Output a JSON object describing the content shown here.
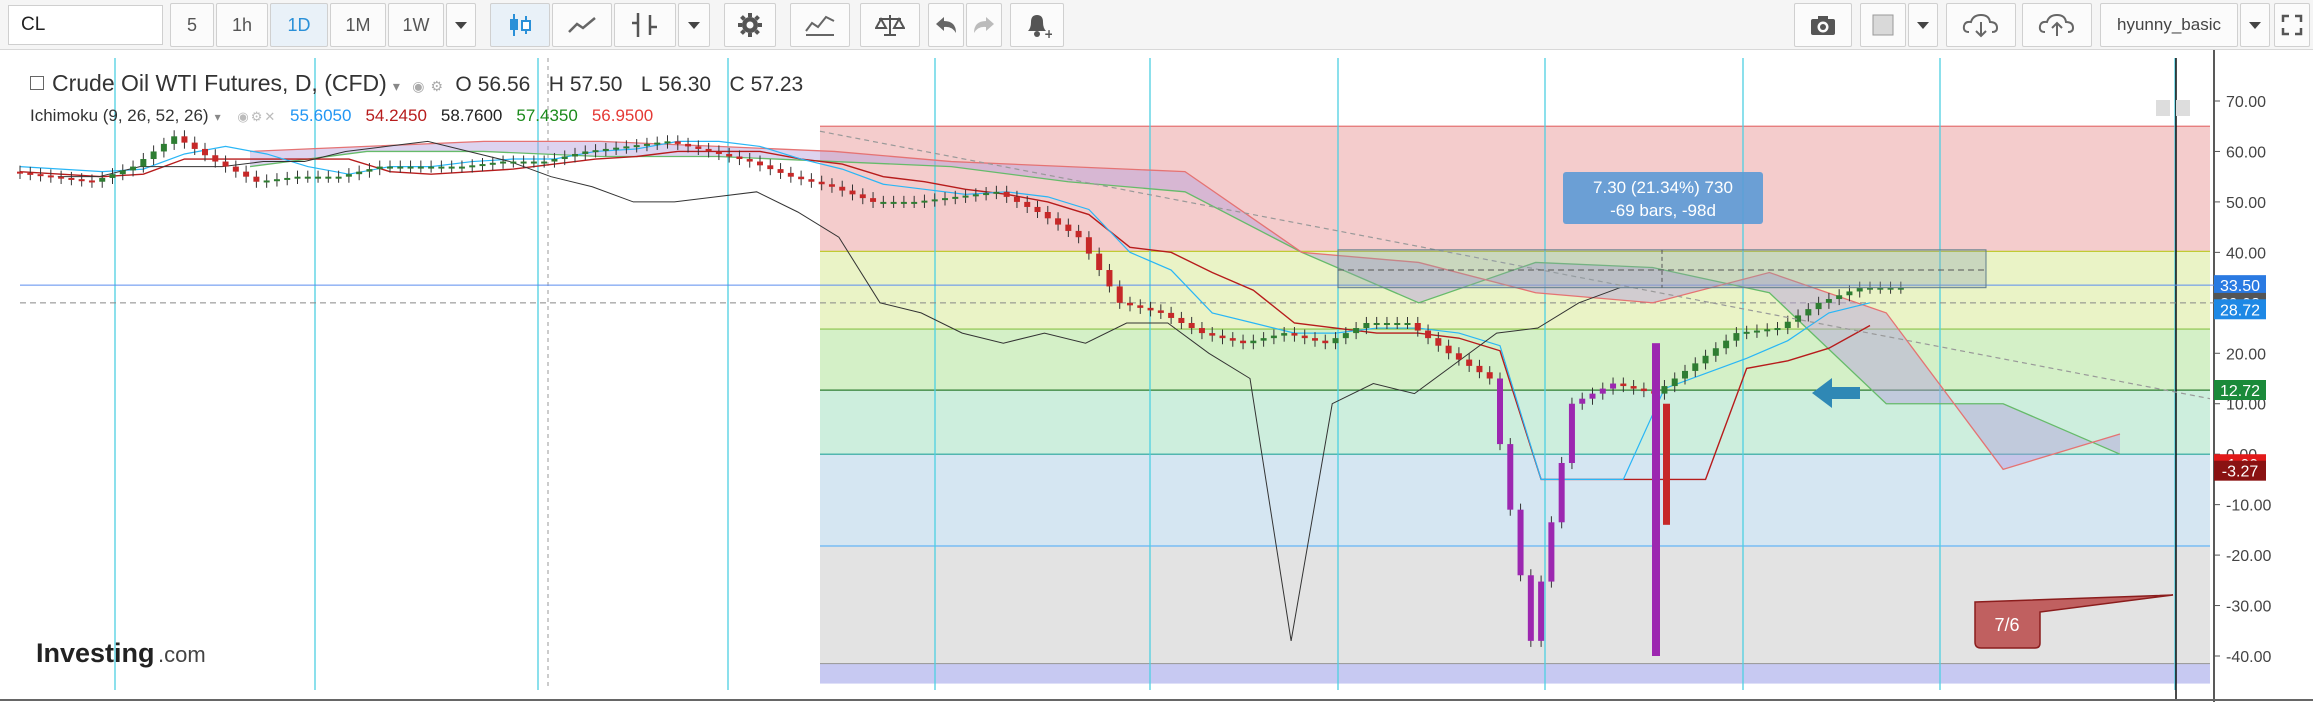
{
  "toolbar": {
    "symbol": "CL",
    "intervals": [
      "5",
      "1h",
      "1D",
      "1M",
      "1W"
    ],
    "active_interval": "1D",
    "user": "hyunny_basic",
    "icons": [
      "candles-icon",
      "line-chart-icon",
      "indicator-icon",
      "settings-icon",
      "compare-icon",
      "balance-icon",
      "undo-icon",
      "redo-icon",
      "alert-icon",
      "camera-icon",
      "color-box-icon",
      "cloud-down-icon",
      "cloud-up-icon",
      "fullscreen-icon"
    ]
  },
  "legend": {
    "title": "Crude Oil WTI Futures, D, (CFD)",
    "ohlc": {
      "o_label": "O",
      "o": "56.56",
      "h_label": "H",
      "h": "57.50",
      "l_label": "L",
      "l": "56.30",
      "c_label": "C",
      "c": "57.23"
    },
    "indicator": "Ichimoku (9, 26, 52, 26)",
    "indicator_values": [
      {
        "value": "55.6050",
        "color": "#2196f3"
      },
      {
        "value": "54.2450",
        "color": "#b71c1c"
      },
      {
        "value": "58.7600",
        "color": "#222222"
      },
      {
        "value": "57.4350",
        "color": "#1b8a1b"
      },
      {
        "value": "56.9500",
        "color": "#e53935"
      }
    ]
  },
  "measure": {
    "line1": "7.30 (21.34%) 730",
    "line2": "-69 bars, -98d"
  },
  "callout": {
    "label": "7/6"
  },
  "brand": {
    "main": "Investing",
    "suffix": ".com"
  },
  "price_labels": [
    {
      "value": "33.50",
      "bg": "#2a7ae2"
    },
    {
      "value": "29.98",
      "bg": "#555555"
    },
    {
      "value": "28.72",
      "bg": "#1e88e5"
    },
    {
      "value": "12.72",
      "bg": "#1a8a3a"
    },
    {
      "value": "-1.99",
      "bg": "#e21a1a"
    },
    {
      "value": "-3.27",
      "bg": "#8a1212"
    }
  ],
  "colors": {
    "up": "#2e7d32",
    "down": "#c62828",
    "special": "#9c27b0",
    "tenkan": "#29b6f6",
    "kijun": "#b71c1c",
    "chikou": "#333333"
  },
  "chart_data": {
    "type": "candlestick",
    "title": "Crude Oil WTI Futures, D, (CFD)",
    "y_ticks": [
      70,
      60,
      50,
      40,
      30,
      20,
      10,
      0,
      -10,
      -20,
      -30,
      -40
    ],
    "ylim": [
      -45,
      74
    ],
    "fib_levels": [
      65,
      40.2,
      24.8,
      12.7,
      0,
      -18.2,
      -41.5
    ],
    "fib_zone_colors": [
      "#f4cccc",
      "#eaf3c6",
      "#d4f0c7",
      "#cdeedd",
      "#d5e6f2",
      "#e3e3e3",
      "#c7c9f2"
    ],
    "trend_levels": [
      33.5,
      29.98
    ],
    "price_path": [
      56,
      55,
      54,
      57,
      63,
      58,
      54,
      55,
      55,
      57,
      57,
      57,
      58,
      58,
      60,
      61,
      62,
      60,
      58,
      55,
      53,
      50,
      50,
      51,
      52,
      48,
      43,
      30,
      28,
      24,
      22,
      24,
      22,
      26,
      26,
      20,
      15,
      -37,
      10,
      14,
      12,
      18,
      24,
      25,
      30,
      33
    ],
    "ichimoku_cloud_span_a": [
      57,
      60,
      60,
      59,
      59,
      58,
      57,
      54,
      52,
      40,
      30,
      38,
      37,
      32,
      10,
      10,
      0
    ],
    "ichimoku_cloud_span_b": [
      60,
      61,
      62,
      62,
      61,
      60,
      58,
      57,
      56,
      40,
      38,
      32,
      30,
      36,
      28,
      -3,
      4
    ]
  },
  "hint": {
    "label": "0.00"
  }
}
